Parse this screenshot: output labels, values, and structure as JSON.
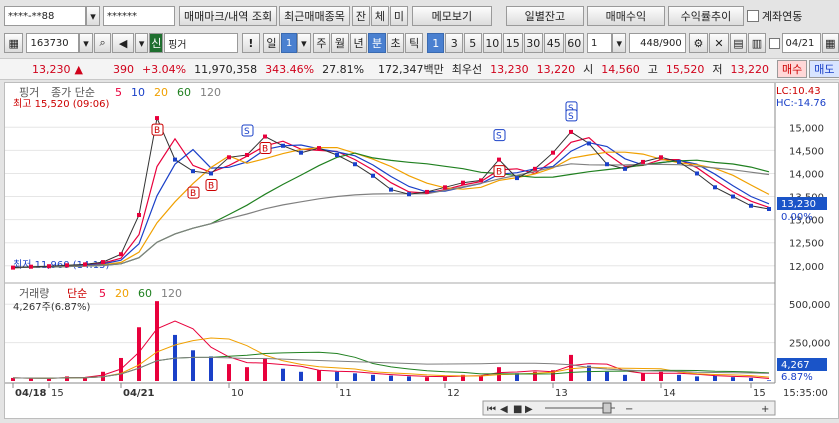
{
  "account": {
    "number": "****-**88",
    "password": "******"
  },
  "toolbar1": {
    "trade_mark": "매매마크/내역 조회",
    "recent_trades": "최근매매종목",
    "btn_jan": "잔",
    "btn_che": "체",
    "btn_mi": "미",
    "memo": "메모보기",
    "daily_balance": "일별잔고",
    "trade_profit": "매매수익",
    "profit_trend": "수익률추이",
    "account_link": "계좌연동"
  },
  "toolbar2": {
    "code": "163730",
    "shin": "신",
    "name": "핑거",
    "excl": "!",
    "period_day": "일",
    "period_num": "1",
    "period_week": "주",
    "period_month": "월",
    "period_year": "년",
    "period_minute": "분",
    "period_second": "초",
    "period_tick": "틱",
    "intervals": [
      "1",
      "3",
      "5",
      "10",
      "15",
      "30",
      "45",
      "60"
    ],
    "interval_box": "1",
    "count": "448",
    "count_total": "/900",
    "date": "04/21"
  },
  "quote": {
    "price": "13,230",
    "arrow": "▲",
    "change": "390",
    "change_pct": "+3.04%",
    "volume": "11,970,358",
    "volume_ratio": "343.46%",
    "turnover": "27.81%",
    "amount": "172,347백만",
    "prev_label": "최우선",
    "ask": "13,230",
    "bid": "13,220",
    "label_si": "시",
    "open": "14,560",
    "label_go": "고",
    "high": "15,520",
    "label_jeo": "저",
    "low": "13,220",
    "buy": "매수",
    "sell": "매도"
  },
  "price_panel": {
    "name": "핑거",
    "legend_prefix": "종가 단순",
    "ma": [
      "5",
      "10",
      "20",
      "60",
      "120"
    ],
    "ma_colors": [
      "#e8003c",
      "#1a40c8",
      "#f0a000",
      "#208020",
      "#808080"
    ],
    "high_note": "최고 15,520 (09:06)",
    "low_note": "최저 11,960 (14:15)",
    "lc": "LC:10.43",
    "hc": "HC:-14.76",
    "y_ticks": [
      "15,000",
      "14,500",
      "14,000",
      "13,500",
      "13,000",
      "12,500",
      "12,000"
    ],
    "current_tag": "13,230",
    "current_pct": "0.00%"
  },
  "volume_panel": {
    "name": "거래량",
    "legend_prefix": "단순",
    "ma": [
      "5",
      "20",
      "60",
      "120"
    ],
    "ma_colors": [
      "#e8003c",
      "#f0a000",
      "#208020",
      "#808080"
    ],
    "current": "4,267주(6.87%)",
    "y_ticks": [
      "500,000",
      "250,000"
    ],
    "tag_value": "4,267",
    "tag_pct": "6.87%"
  },
  "x_axis": {
    "labels": [
      "04/18",
      "15",
      "04/21",
      "10",
      "11",
      "12",
      "13",
      "14",
      "15"
    ],
    "time": "15:35:00"
  },
  "chart_data": {
    "type": "line",
    "title": "",
    "series": [
      {
        "name": "종가",
        "values": [
          11960,
          11980,
          11990,
          12010,
          12030,
          12080,
          12250,
          13100,
          15200,
          14300,
          14050,
          14000,
          14350,
          14400,
          14800,
          14600,
          14450,
          14550,
          14400,
          14200,
          13950,
          13650,
          13550,
          13600,
          13700,
          13800,
          13850,
          14300,
          13900,
          14100,
          14450,
          14900,
          14650,
          14200,
          14100,
          14250,
          14350,
          14250,
          14000,
          13700,
          13500,
          13300,
          13230
        ]
      },
      {
        "name": "거래량",
        "values": [
          20000,
          18000,
          15000,
          30000,
          25000,
          60000,
          150000,
          350000,
          520000,
          300000,
          200000,
          160000,
          110000,
          90000,
          150000,
          80000,
          60000,
          70000,
          60000,
          50000,
          40000,
          35000,
          30000,
          25000,
          30000,
          40000,
          35000,
          90000,
          50000,
          60000,
          70000,
          170000,
          100000,
          60000,
          40000,
          50000,
          60000,
          40000,
          30000,
          35000,
          25000,
          20000,
          4267
        ]
      }
    ],
    "ylim": [
      11800,
      15700
    ]
  }
}
